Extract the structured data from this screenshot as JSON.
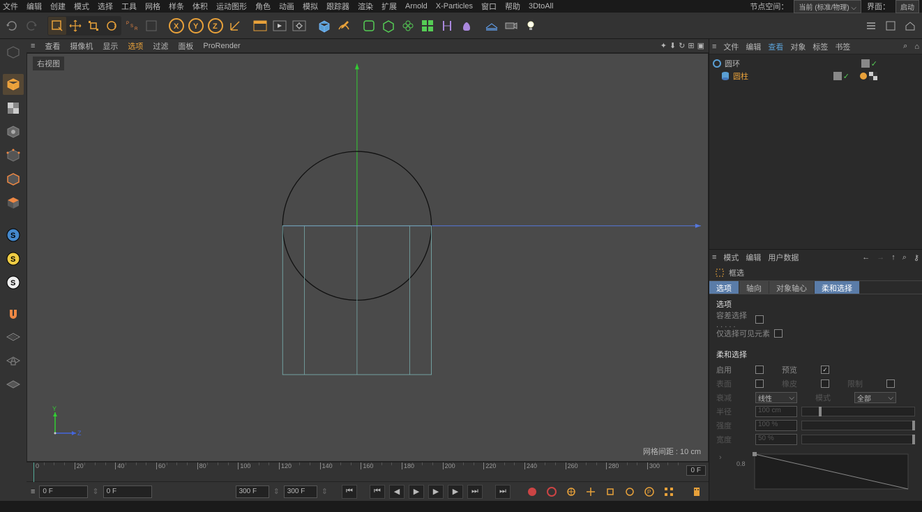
{
  "menubar": {
    "items": [
      "文件",
      "编辑",
      "创建",
      "模式",
      "选择",
      "工具",
      "网格",
      "样条",
      "体积",
      "运动图形",
      "角色",
      "动画",
      "模拟",
      "跟踪器",
      "渲染",
      "扩展",
      "Arnold",
      "X-Particles",
      "窗口",
      "帮助",
      "3DtoAll"
    ],
    "node_space_label": "节点空间：",
    "node_space_value": "当前 (标准/物理)",
    "interface_label": "界面：",
    "interface_value": "启动"
  },
  "viewport_menu": {
    "items": [
      "查看",
      "摄像机",
      "显示",
      "选项",
      "过滤",
      "面板",
      "ProRender"
    ],
    "active_index": 3
  },
  "viewport": {
    "label": "右视图",
    "grid_label": "网格间距 : 10 cm",
    "axis_y": "Y",
    "axis_z": "Z"
  },
  "timeline": {
    "start": 0,
    "end": 300,
    "step": 20,
    "frame_current": "0 F",
    "frame_start": "0 F",
    "frame_end": "300 F",
    "frame_range": "300 F",
    "frame_display": "0 F"
  },
  "objects_panel": {
    "tabs": [
      "文件",
      "编辑",
      "查看",
      "对象",
      "标签",
      "书签"
    ],
    "active_tab_index": 2,
    "items": [
      {
        "name": "圆环",
        "selected": false
      },
      {
        "name": "圆柱",
        "selected": true
      }
    ]
  },
  "attributes_panel": {
    "tabs": [
      "模式",
      "编辑",
      "用户数据"
    ],
    "tool_name": "框选",
    "subtabs": [
      "选项",
      "轴向",
      "对象轴心",
      "柔和选择"
    ],
    "active_subtab": 0,
    "highlight_subtab": 3,
    "section_options": {
      "title": "选项",
      "tolerance": {
        "label": "容差选择",
        "checked": false
      },
      "visible_only": {
        "label": "仅选择可见元素",
        "checked": false
      }
    },
    "section_soft": {
      "title": "柔和选择",
      "enable": {
        "label": "启用",
        "checked": false
      },
      "preview": {
        "label": "预览",
        "checked": true
      },
      "surface": {
        "label": "表面",
        "checked": false
      },
      "rubber": {
        "label": "橡皮",
        "checked": false
      },
      "limit": {
        "label": "限制",
        "checked": false
      },
      "falloff": {
        "label": "衰减",
        "value": "线性"
      },
      "mode": {
        "label": "模式",
        "value": "全部"
      },
      "radius": {
        "label": "半径",
        "value": "100 cm"
      },
      "strength": {
        "label": "强度",
        "value": "100 %"
      },
      "width": {
        "label": "宽度",
        "value": "50 %"
      }
    },
    "curve_label": "0.8"
  }
}
